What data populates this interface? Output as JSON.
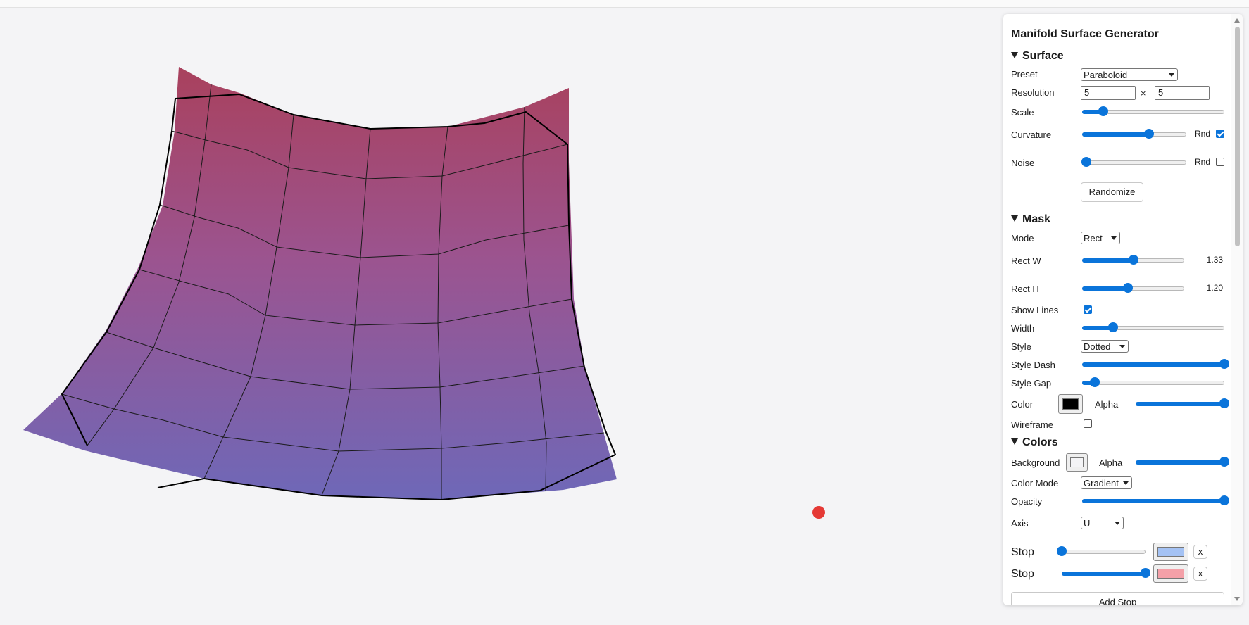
{
  "panel": {
    "title": "Manifold Surface Generator",
    "surface": {
      "header": "Surface",
      "preset_label": "Preset",
      "preset_value": "Paraboloid",
      "resolution_label": "Resolution",
      "res_u": "5",
      "res_x": "×",
      "res_v": "5",
      "scale_label": "Scale",
      "scale_level": 0.15,
      "curvature_label": "Curvature",
      "curvature_level": 0.64,
      "curvature_rnd_label": "Rnd",
      "curvature_rnd_checked": true,
      "noise_label": "Noise",
      "noise_level": 0.04,
      "noise_rnd_label": "Rnd",
      "noise_rnd_checked": false,
      "randomize_label": "Randomize"
    },
    "mask": {
      "header": "Mask",
      "mode_label": "Mode",
      "mode_value": "Rect",
      "rect_w_label": "Rect W",
      "rect_w_value": "1.33",
      "rect_w_level": 0.5,
      "rect_h_label": "Rect H",
      "rect_h_value": "1.20",
      "rect_h_level": 0.45,
      "show_lines_label": "Show Lines",
      "show_lines_checked": true,
      "width_label": "Width",
      "width_level": 0.22,
      "style_label": "Style",
      "style_value": "Dotted",
      "style_dash_label": "Style Dash",
      "style_dash_level": 1.0,
      "style_gap_label": "Style Gap",
      "style_gap_level": 0.09,
      "color_label": "Color",
      "color_value": "#000000",
      "alpha_label": "Alpha",
      "alpha_level": 1.0,
      "wireframe_label": "Wireframe",
      "wireframe_checked": false
    },
    "colors": {
      "header": "Colors",
      "background_label": "Background",
      "background_value": "#f4f4f6",
      "alpha_label": "Alpha",
      "alpha_level": 1.0,
      "color_mode_label": "Color Mode",
      "color_mode_value": "Gradient",
      "opacity_label": "Opacity",
      "opacity_level": 1.0,
      "axis_label": "Axis",
      "axis_value": "U",
      "stops": [
        {
          "label": "Stop",
          "level": 0.0,
          "color": "#a4c2f4",
          "remove_label": "x"
        },
        {
          "label": "Stop",
          "level": 1.0,
          "color": "#f4a0a8",
          "remove_label": "x"
        }
      ],
      "add_stop_label": "Add Stop"
    }
  }
}
